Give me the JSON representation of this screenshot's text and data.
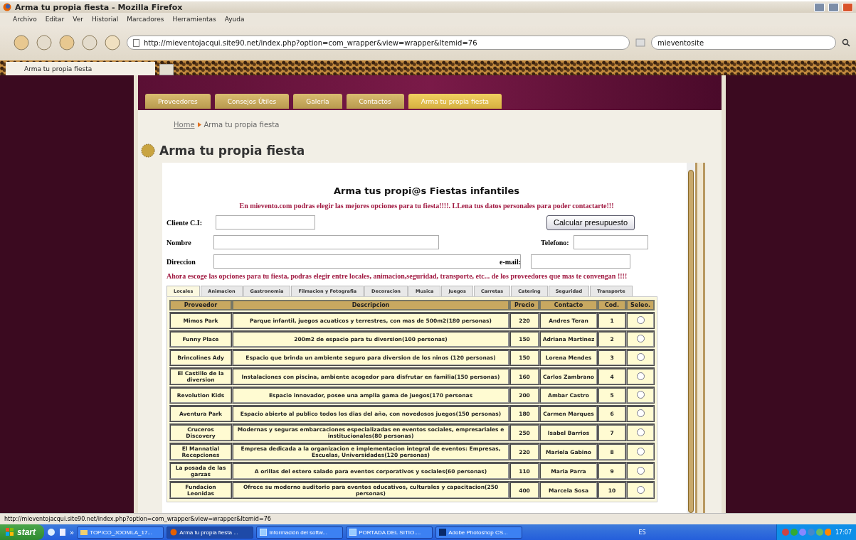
{
  "window": {
    "title": "Arma tu propia fiesta - Mozilla Firefox"
  },
  "menu_bar": [
    "Archivo",
    "Editar",
    "Ver",
    "Historial",
    "Marcadores",
    "Herramientas",
    "Ayuda"
  ],
  "address_bar": {
    "value": "http://mieventojacqui.site90.net/index.php?option=com_wrapper&view=wrapper&Itemid=76"
  },
  "search_bar": {
    "value": "mieventosite"
  },
  "browser_tabs": [
    {
      "label": "Arma tu propia fiesta",
      "selected": true
    }
  ],
  "site_menu": [
    {
      "label": "Proveedores",
      "selected": false
    },
    {
      "label": "Consejos Útiles",
      "selected": false
    },
    {
      "label": "Galería",
      "selected": false
    },
    {
      "label": "Contactos",
      "selected": false
    },
    {
      "label": "Arma tu propia fiesta",
      "selected": true
    }
  ],
  "breadcrumb": {
    "home": "Home",
    "current": "Arma tu propia fiesta"
  },
  "page_title": "Arma tu propia fiesta",
  "form": {
    "title": "Arma tus propi@s Fiestas infantiles",
    "intro": "En mievento.com podras elegir las mejores opciones para tu fiesta!!!!. LLena tus datos personales para poder contactarte!!!",
    "button": "Calcular presupuesto",
    "fields": [
      {
        "label": "Cliente C.I:"
      },
      {
        "label": "Nombre"
      },
      {
        "label": "Telefono:"
      },
      {
        "label": "Direccion"
      },
      {
        "label": "e-mail:"
      }
    ],
    "note": "Ahora escoge las opciones para tu fiesta, podras elegir entre locales, animacion,seguridad, transporte, etc... de los proveedores que mas te convengan !!!!"
  },
  "category_tabs": [
    {
      "label": "Locales",
      "selected": true
    },
    {
      "label": "Animacion",
      "selected": false
    },
    {
      "label": "Gastronomia",
      "selected": false
    },
    {
      "label": "Filmacion y Fotografia",
      "selected": false
    },
    {
      "label": "Decoracion",
      "selected": false
    },
    {
      "label": "Musica",
      "selected": false
    },
    {
      "label": "Juegos",
      "selected": false
    },
    {
      "label": "Carretas",
      "selected": false
    },
    {
      "label": "Catering",
      "selected": false
    },
    {
      "label": "Seguridad",
      "selected": false
    },
    {
      "label": "Transporte",
      "selected": false
    }
  ],
  "table": {
    "columns": [
      "Proveedor",
      "Descripcion",
      "Precio",
      "Contacto",
      "Cod.",
      "Seleo."
    ],
    "rows": [
      {
        "cells": [
          "Mimos Park",
          "Parque infantil, juegos acuaticos y terrestres, con mas de 500m2(180 personas)",
          "220",
          "Andres Teran",
          "1"
        ],
        "selected": false
      },
      {
        "cells": [
          "Funny Place",
          "200m2 de espacio para tu diversion(100 personas)",
          "150",
          "Adriana Martinez",
          "2"
        ],
        "selected": false
      },
      {
        "cells": [
          "Brincolines Ady",
          "Espacio que brinda un ambiente seguro para diversion de los ninos (120 personas)",
          "150",
          "Lorena Mendes",
          "3"
        ],
        "selected": false
      },
      {
        "cells": [
          "El Castillo de la diversion",
          "Instalaciones con piscina, ambiente acogedor para disfrutar en familia(150 personas)",
          "160",
          "Carlos Zambrano",
          "4"
        ],
        "selected": false
      },
      {
        "cells": [
          "Revolution Kids",
          "Espacio innovador, posee una amplia gama de juegos(170 personas",
          "200",
          "Ambar Castro",
          "5"
        ],
        "selected": false
      },
      {
        "cells": [
          "Aventura Park",
          "Espacio abierto al publico todos los dias del año, con novedosos juegos(150 personas)",
          "180",
          "Carmen Marques",
          "6"
        ],
        "selected": false
      },
      {
        "cells": [
          "Cruceros Discovery",
          "Modernas y seguras embarcaciones especializadas en eventos sociales, empresariales e institucionales(80 personas)",
          "250",
          "Isabel Barrios",
          "7"
        ],
        "selected": false
      },
      {
        "cells": [
          "El Mannatial Recepciones",
          "Empresa dedicada a la organizacion e implementacion integral de eventos: Empresas, Escuelas, Universidades(120 personas)",
          "220",
          "Mariela Gabino",
          "8"
        ],
        "selected": false
      },
      {
        "cells": [
          "La posada de las garzas",
          "A orillas del estero salado para eventos corporativos y sociales(60 personas)",
          "110",
          "Maria Parra",
          "9"
        ],
        "selected": false
      },
      {
        "cells": [
          "Fundacion Leonidas",
          "Ofrece su moderno auditorio para eventos educativos, culturales y capacitacion(250 personas)",
          "400",
          "Marcela Sosa",
          "10"
        ],
        "selected": false
      }
    ]
  },
  "status_bar": "http://mieventojacqui.site90.net/index.php?option=com_wrapper&view=wrapper&Itemid=76",
  "taskbar": {
    "start": "start",
    "more": "»",
    "tasks": [
      {
        "label": "TOPICO_JOOMLA_17...",
        "kind": "folder",
        "selected": false
      },
      {
        "label": "Arma tu propia fiesta ...",
        "kind": "firefox",
        "selected": true
      },
      {
        "label": "Información del softw...",
        "kind": "window",
        "selected": false
      },
      {
        "label": "PORTADA DEL SITIO....",
        "kind": "window",
        "selected": false
      },
      {
        "label": "Adobe Photoshop CS...",
        "kind": "photoshop",
        "selected": false
      }
    ],
    "language": "ES",
    "clock": "17:07"
  }
}
